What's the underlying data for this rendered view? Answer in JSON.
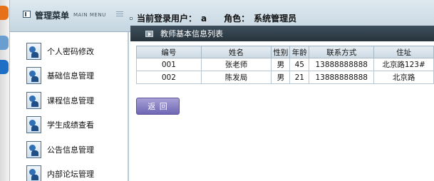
{
  "header": {
    "menu_title": "管理菜单",
    "menu_subtitle": "MAIN MENU",
    "login_label": "当前登录用户：",
    "login_user": "a",
    "role_label": "角色：",
    "role_value": "系统管理员"
  },
  "sidebar": {
    "items": [
      {
        "label": "个人密码修改",
        "icon": "user-icon"
      },
      {
        "label": "基础信息管理",
        "icon": "user-icon"
      },
      {
        "label": "课程信息管理",
        "icon": "user-icon"
      },
      {
        "label": "学生成绩查看",
        "icon": "user-icon"
      },
      {
        "label": "公告信息管理",
        "icon": "user-icon"
      },
      {
        "label": "内部论坛管理",
        "icon": "user-icon"
      }
    ]
  },
  "panel": {
    "title": "教师基本信息列表"
  },
  "table": {
    "headers": [
      "编号",
      "姓名",
      "性别",
      "年龄",
      "联系方式",
      "住址"
    ],
    "rows": [
      [
        "001",
        "张老师",
        "男",
        "45",
        "13888888888",
        "北京路123#"
      ],
      [
        "002",
        "陈发局",
        "男",
        "21",
        "13888888888",
        "北京路"
      ]
    ]
  },
  "actions": {
    "back_label": "返 回"
  },
  "colors": {
    "panel_header": "#28343d",
    "button": "#6f66b4",
    "topbar": "#c5d6e1"
  }
}
